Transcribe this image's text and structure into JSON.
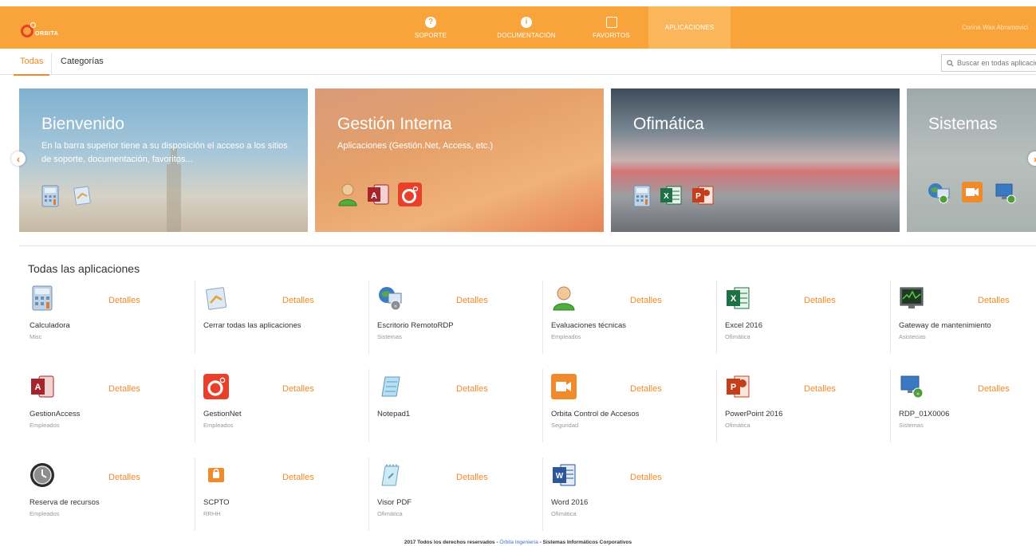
{
  "header": {
    "logo_text": "ORBITA",
    "nav": [
      {
        "label": "SOPORTE",
        "icon": "question-circle-icon"
      },
      {
        "label": "DOCUMENTACIÓN",
        "icon": "info-circle-icon"
      },
      {
        "label": "FAVORITOS",
        "icon": "bookmark-icon"
      },
      {
        "label": "APLICACIONES",
        "icon": "apps-grid-icon",
        "active": true
      }
    ],
    "user": "Corina Wax Abramovici"
  },
  "tabs": {
    "all": "Todas",
    "categories": "Categorías",
    "search_placeholder": "Buscar en todas aplicaciones"
  },
  "banners": [
    {
      "title": "Bienvenido",
      "text": "En la barra superior tiene a su disposición el acceso a los sitios de soporte, documentación, favoritos..."
    },
    {
      "title": "Gestión Interna",
      "text": "Aplicaciones (Gestión.Net, Access, etc.)"
    },
    {
      "title": "Ofimática",
      "text": ""
    },
    {
      "title": "Sistemas",
      "text": ""
    }
  ],
  "section_title": "Todas las aplicaciones",
  "details_label": "Detalles",
  "apps": [
    {
      "name": "Calculadora",
      "category": "Misc",
      "icon": "calculator-icon"
    },
    {
      "name": "Cerrar todas las aplicaciones",
      "category": "",
      "icon": "close-apps-icon"
    },
    {
      "name": "Escritorio RemotoRDP",
      "category": "Sistemas",
      "icon": "remote-desktop-icon"
    },
    {
      "name": "Evaluaciones técnicas",
      "category": "Empleados",
      "icon": "user-icon"
    },
    {
      "name": "Excel 2016",
      "category": "Ofimática",
      "icon": "excel-icon"
    },
    {
      "name": "Gateway de mantenimiento",
      "category": "Asistecias",
      "icon": "monitor-chart-icon"
    },
    {
      "name": "GestionAccess",
      "category": "Empleados",
      "icon": "access-icon"
    },
    {
      "name": "GestionNet",
      "category": "Empleados",
      "icon": "orbita-logo-icon"
    },
    {
      "name": "Notepad1",
      "category": "",
      "icon": "notepad-icon"
    },
    {
      "name": "Orbita Control de Accesos",
      "category": "Seguridad",
      "icon": "camera-icon"
    },
    {
      "name": "PowerPoint 2016",
      "category": "Ofimática",
      "icon": "powerpoint-icon"
    },
    {
      "name": "RDP_01X0006",
      "category": "Sistemas",
      "icon": "rdp-monitor-icon"
    },
    {
      "name": "Reserva de recursos",
      "category": "Empleados",
      "icon": "clock-icon"
    },
    {
      "name": "SCPTO",
      "category": "RRHH",
      "icon": "lock-icon"
    },
    {
      "name": "Visor PDF",
      "category": "Ofimática",
      "icon": "pdf-notepad-icon"
    },
    {
      "name": "Word 2016",
      "category": "Ofimática",
      "icon": "word-icon"
    }
  ],
  "footer": {
    "text": "2017 Todos los derechos reservados -",
    "link": "Órbita Ingeniería",
    "text2": "- Sistemas Informáticos Corporativos"
  },
  "colors": {
    "header": "#f9a43a",
    "accent": "#f08a2a"
  }
}
